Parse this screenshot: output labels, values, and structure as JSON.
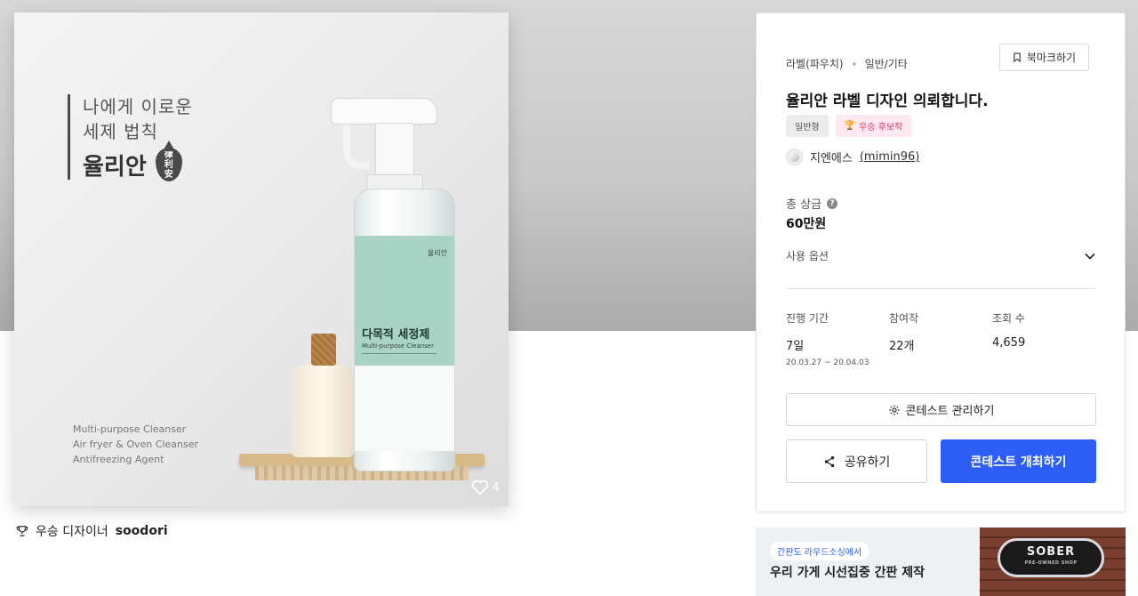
{
  "hero": {
    "line1": "나에게 이로운",
    "line2": "세제 법칙",
    "brand": "율리안",
    "drop_chars": [
      "律",
      "利",
      "安"
    ],
    "eng_lines": [
      "Multi-purpose Cleanser",
      "Air fryer & Oven Cleanser",
      "Antifreezing Agent"
    ],
    "label_brand": "율리안",
    "label_title": "다목적 세정제",
    "label_sub": "Multi-purpose Cleanser",
    "likes": "4"
  },
  "winner": {
    "prefix": "우승 디자이너",
    "name": "soodori"
  },
  "panel": {
    "breadcrumb": [
      "라벨(파우치)",
      "일반/기타"
    ],
    "bookmark_label": "북마크하기",
    "title": "율리안 라벨 디자인 의뢰합니다.",
    "tags": [
      "일반형",
      "우승 후보작"
    ],
    "author_name": "지엔에스",
    "author_id": "(mimin96)",
    "prize_label": "총 상금",
    "prize_value": "60만원",
    "usage_label": "사용 옵션",
    "stats": [
      {
        "label": "진행 기간",
        "value": "7일",
        "sub": "20.03.27 ~ 20.04.03"
      },
      {
        "label": "참여작",
        "value": "22개"
      },
      {
        "label": "조회 수",
        "value": "4,659"
      }
    ],
    "manage_label": "콘테스트 관리하기",
    "share_label": "공유하기",
    "host_label": "콘테스트 개최하기"
  },
  "banner": {
    "chip": "간판도 라우드소싱에서",
    "text": "우리 가게 시선집중 간판 제작",
    "sign_main": "SOBER",
    "sign_sub": "PRE-OWNED SHOP"
  },
  "colors": {
    "primary": "#2b5ef6",
    "tag_pink": "#e0336b",
    "label_green": "#a9d3c5"
  }
}
